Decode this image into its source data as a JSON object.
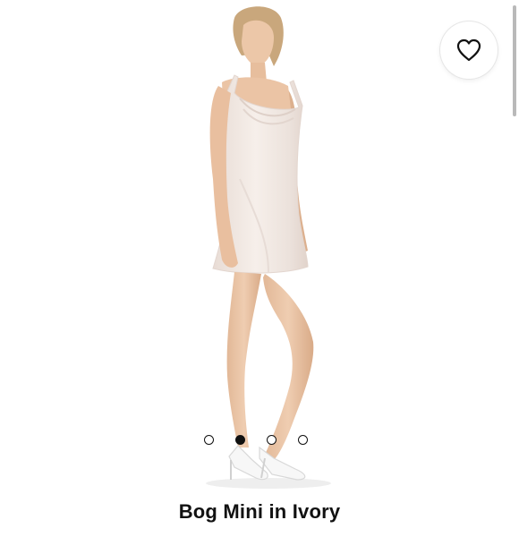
{
  "product": {
    "title": "Bog Mini in Ivory"
  },
  "favorite": {
    "icon": "heart-outline-icon"
  },
  "carousel": {
    "slide_count": 4,
    "active_index": 1
  },
  "colors": {
    "background": "#ffffff",
    "dress": "#f1e9e4",
    "skin": "#e9c3a4",
    "active_dot": "#111111"
  }
}
